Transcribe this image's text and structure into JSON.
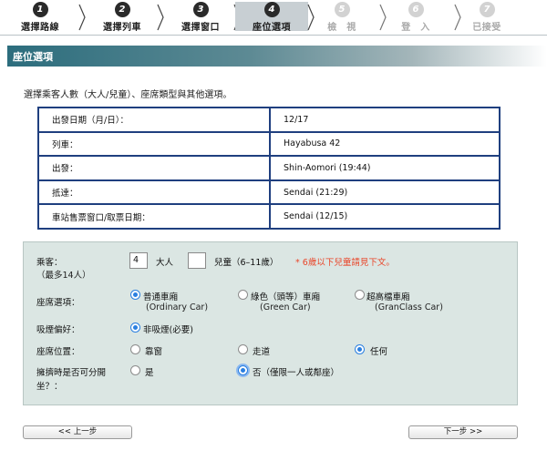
{
  "steps": [
    {
      "num": "1",
      "label": "選擇路線",
      "state": "done"
    },
    {
      "num": "2",
      "label": "選擇列車",
      "state": "done"
    },
    {
      "num": "3",
      "label": "選擇窗口",
      "state": "done"
    },
    {
      "num": "4",
      "label": "座位選項",
      "state": "current"
    },
    {
      "num": "5",
      "label": "檢　視",
      "state": "todo"
    },
    {
      "num": "6",
      "label": "登　入",
      "state": "todo"
    },
    {
      "num": "7",
      "label": "已接受",
      "state": "todo"
    }
  ],
  "header": {
    "title": "座位選項"
  },
  "instruction": "選擇乘客人數（大人/兒童）、座席類型與其他選項。",
  "summary": [
    {
      "label": "出發日期（月/日）：",
      "value": "12/17"
    },
    {
      "label": "列車：",
      "value": "Hayabusa 42"
    },
    {
      "label": "出發：",
      "value": "Shin-Aomori (19:44)"
    },
    {
      "label": "抵達：",
      "value": "Sendai (21:29)"
    },
    {
      "label": "車站售票窗口/取票日期：",
      "value": "Sendai (12/15)"
    }
  ],
  "passengers": {
    "label": "乘客：",
    "sublabel": "（最多14人）",
    "adult_value": "4",
    "adult_label": "大人",
    "child_value": "",
    "child_label": "兒童（6–11歲）",
    "note": "* 6歲以下兒童請見下文。"
  },
  "seat_class": {
    "label": "座席選項：",
    "options": [
      {
        "label": "普通車廂",
        "sub": "(Ordinary Car)",
        "selected": true
      },
      {
        "label": "綠色（頭等）車廂",
        "sub": "(Green Car)",
        "selected": false
      },
      {
        "label": "超高檔車廂",
        "sub": "(GranClass Car)",
        "selected": false
      }
    ]
  },
  "smoking": {
    "label": "吸煙偏好：",
    "options": [
      {
        "label": "非吸煙(必要)",
        "selected": true
      }
    ]
  },
  "seat_position": {
    "label": "座席位置：",
    "options": [
      {
        "label": "靠窗",
        "selected": false
      },
      {
        "label": "走道",
        "selected": false
      },
      {
        "label": "任何",
        "selected": true
      }
    ]
  },
  "separate": {
    "label_line1": "擁擠時是否可分開",
    "label_line2": "坐？：",
    "options": [
      {
        "label": "是",
        "selected": false
      },
      {
        "label": "否（僅限一人或鄰座）",
        "selected": true
      }
    ]
  },
  "nav": {
    "back": "<< 上一步",
    "next": "下一步 >>"
  },
  "colors": {
    "done_circle": "#2a2a2a",
    "current_bg": "#c8cfd3",
    "todo_circle": "#d2d2d2",
    "warn": "#e9462a",
    "panel_bg": "#dbe6e3",
    "table_border": "#1f3f7f"
  }
}
